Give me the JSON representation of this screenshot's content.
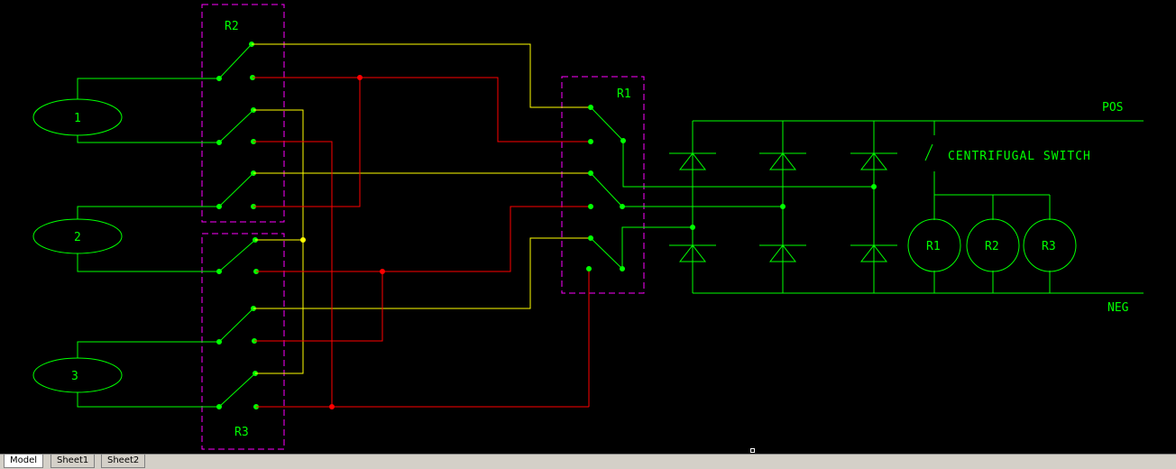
{
  "colors": {
    "background": "#000000",
    "green": "#00ff00",
    "red": "#ff0000",
    "yellow": "#ffff00",
    "magenta": "#ff00ff",
    "text": "#00ff00"
  },
  "relays": {
    "r2": "R2",
    "r3": "R3",
    "r1": "R1"
  },
  "motors": {
    "m1": "1",
    "m2": "2",
    "m3": "3"
  },
  "bus": {
    "pos": "POS",
    "neg": "NEG"
  },
  "switch_label": "CENTRIFUGAL SWITCH",
  "coils": {
    "c1": "R1",
    "c2": "R2",
    "c3": "R3"
  },
  "tabs": [
    "Model",
    "Sheet1",
    "Sheet2"
  ]
}
